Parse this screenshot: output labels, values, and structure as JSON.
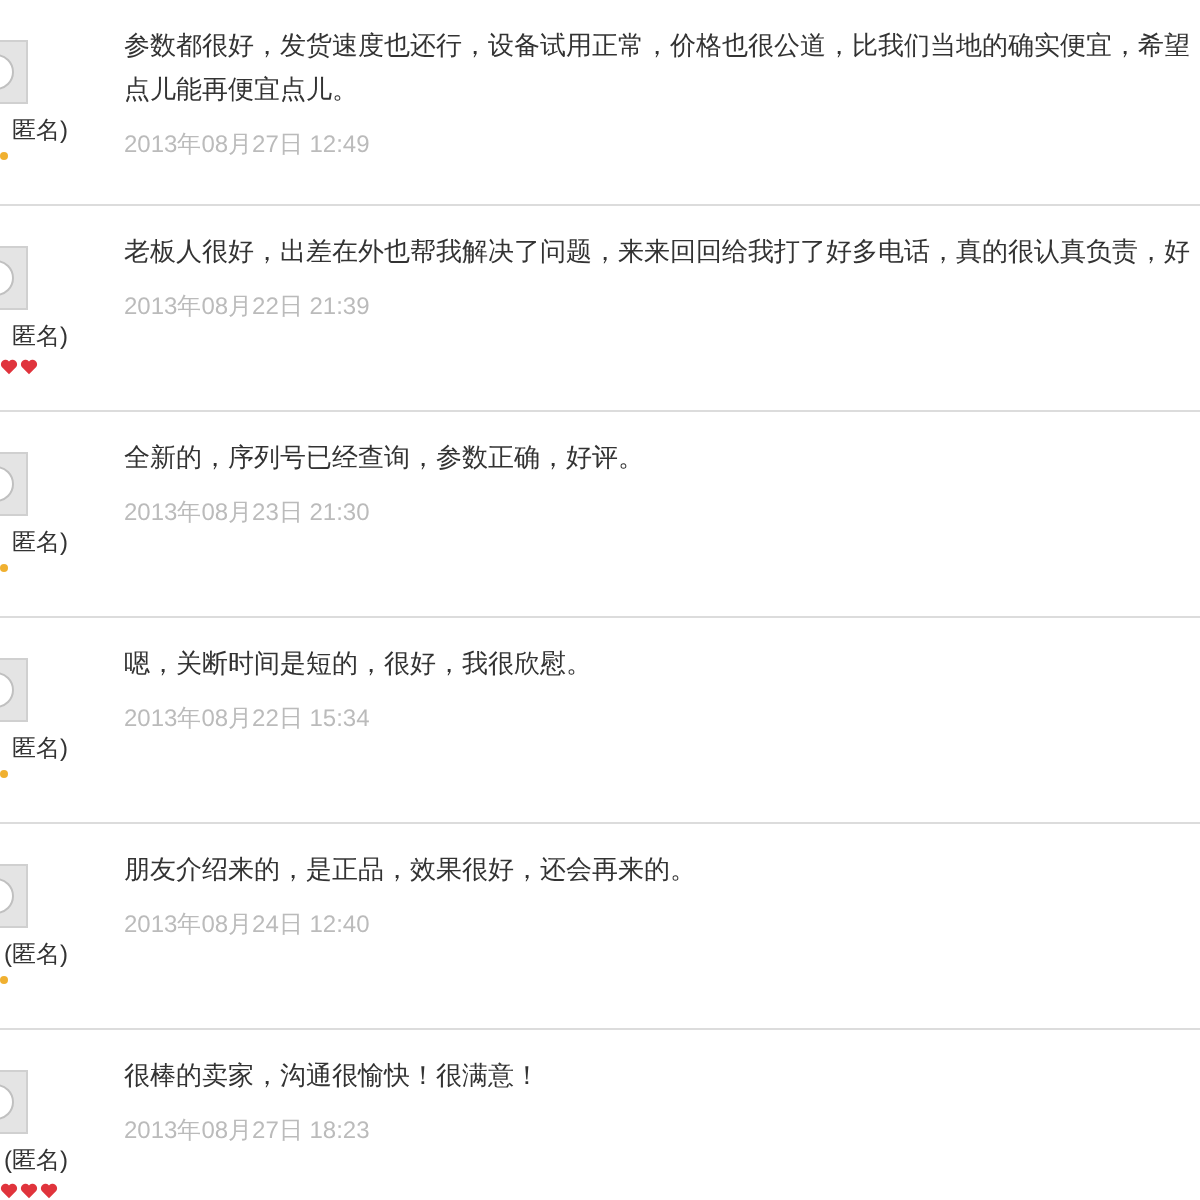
{
  "reviews": [
    {
      "name": "匿名)",
      "rank": [
        {
          "kind": "dot"
        }
      ],
      "lines": [
        "参数都很好，发货速度也还行，设备试用正常，价格也很公道，比我们当地的确实便宜，希望",
        "点儿能再便宜点儿。"
      ],
      "date": "2013年08月27日 12:49"
    },
    {
      "name": "匿名)",
      "rank": [
        {
          "kind": "heart"
        },
        {
          "kind": "heart"
        }
      ],
      "lines": [
        "老板人很好，出差在外也帮我解决了问题，来来回回给我打了好多电话，真的很认真负责，好"
      ],
      "date": "2013年08月22日 21:39"
    },
    {
      "name": "匿名)",
      "rank": [
        {
          "kind": "dot"
        }
      ],
      "lines": [
        "全新的，序列号已经查询，参数正确，好评。"
      ],
      "date": "2013年08月23日 21:30"
    },
    {
      "name": "匿名)",
      "rank": [
        {
          "kind": "dot"
        }
      ],
      "lines": [
        "嗯，关断时间是短的，很好，我很欣慰。"
      ],
      "date": "2013年08月22日 15:34"
    },
    {
      "name": "(匿名)",
      "rank": [
        {
          "kind": "dot"
        }
      ],
      "lines": [
        "朋友介绍来的，是正品，效果很好，还会再来的。"
      ],
      "date": "2013年08月24日 12:40"
    },
    {
      "name": "(匿名)",
      "rank": [
        {
          "kind": "heart"
        },
        {
          "kind": "heart"
        },
        {
          "kind": "heart"
        }
      ],
      "lines": [
        "很棒的卖家，沟通很愉快！很满意！"
      ],
      "date": "2013年08月27日 18:23"
    }
  ]
}
